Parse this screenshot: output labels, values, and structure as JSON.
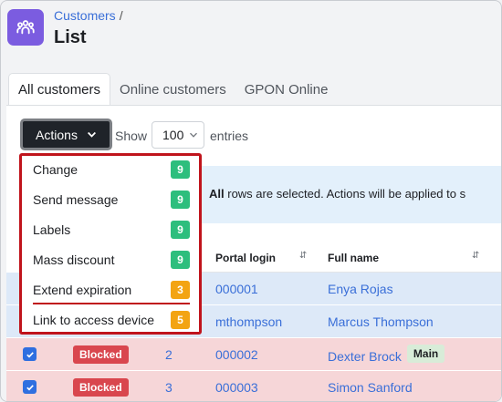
{
  "breadcrumb": {
    "parent": "Customers",
    "separator": "/"
  },
  "page_title": "List",
  "tabs": [
    {
      "label": "All customers",
      "active": true
    },
    {
      "label": "Online customers",
      "active": false
    },
    {
      "label": "GPON Online",
      "active": false
    }
  ],
  "toolbar": {
    "actions_label": "Actions",
    "show_label": "Show",
    "entries_value": "100",
    "entries_label": "entries"
  },
  "info": {
    "strong": "All",
    "text": " rows are selected. Actions will be applied to s"
  },
  "table": {
    "headers": {
      "portal_login": "Portal login",
      "full_name": "Full name"
    },
    "rows": [
      {
        "id": "",
        "status": "",
        "portal_login": "000001",
        "full_name": "Enya Rojas",
        "badge": ""
      },
      {
        "id": "",
        "status": "",
        "portal_login": "mthompson",
        "full_name": "Marcus Thompson",
        "badge": ""
      },
      {
        "id": "2",
        "status": "Blocked",
        "portal_login": "000002",
        "full_name": "Dexter Brock",
        "badge": "Main"
      },
      {
        "id": "3",
        "status": "Blocked",
        "portal_login": "000003",
        "full_name": "Simon Sanford",
        "badge": ""
      }
    ]
  },
  "menu": {
    "items": [
      {
        "label": "Change",
        "count": "9"
      },
      {
        "label": "Send message",
        "count": "9"
      },
      {
        "label": "Labels",
        "count": "9"
      },
      {
        "label": "Mass discount",
        "count": "9"
      },
      {
        "label": "Extend expiration",
        "count": "3"
      },
      {
        "label": "Link to access device",
        "count": "5"
      }
    ]
  },
  "colors": {
    "accent": "#7b5ce0",
    "link": "#3a6fd8",
    "danger": "#d9464e",
    "count_green": "#2dbe7d",
    "count_orange": "#f3a413",
    "highlight_border": "#c0141c"
  },
  "icons": {
    "app": "customers-group-icon",
    "dropdown": "chevron-down-icon",
    "sort": "sort-icon",
    "checkbox": "checkmark-icon"
  }
}
